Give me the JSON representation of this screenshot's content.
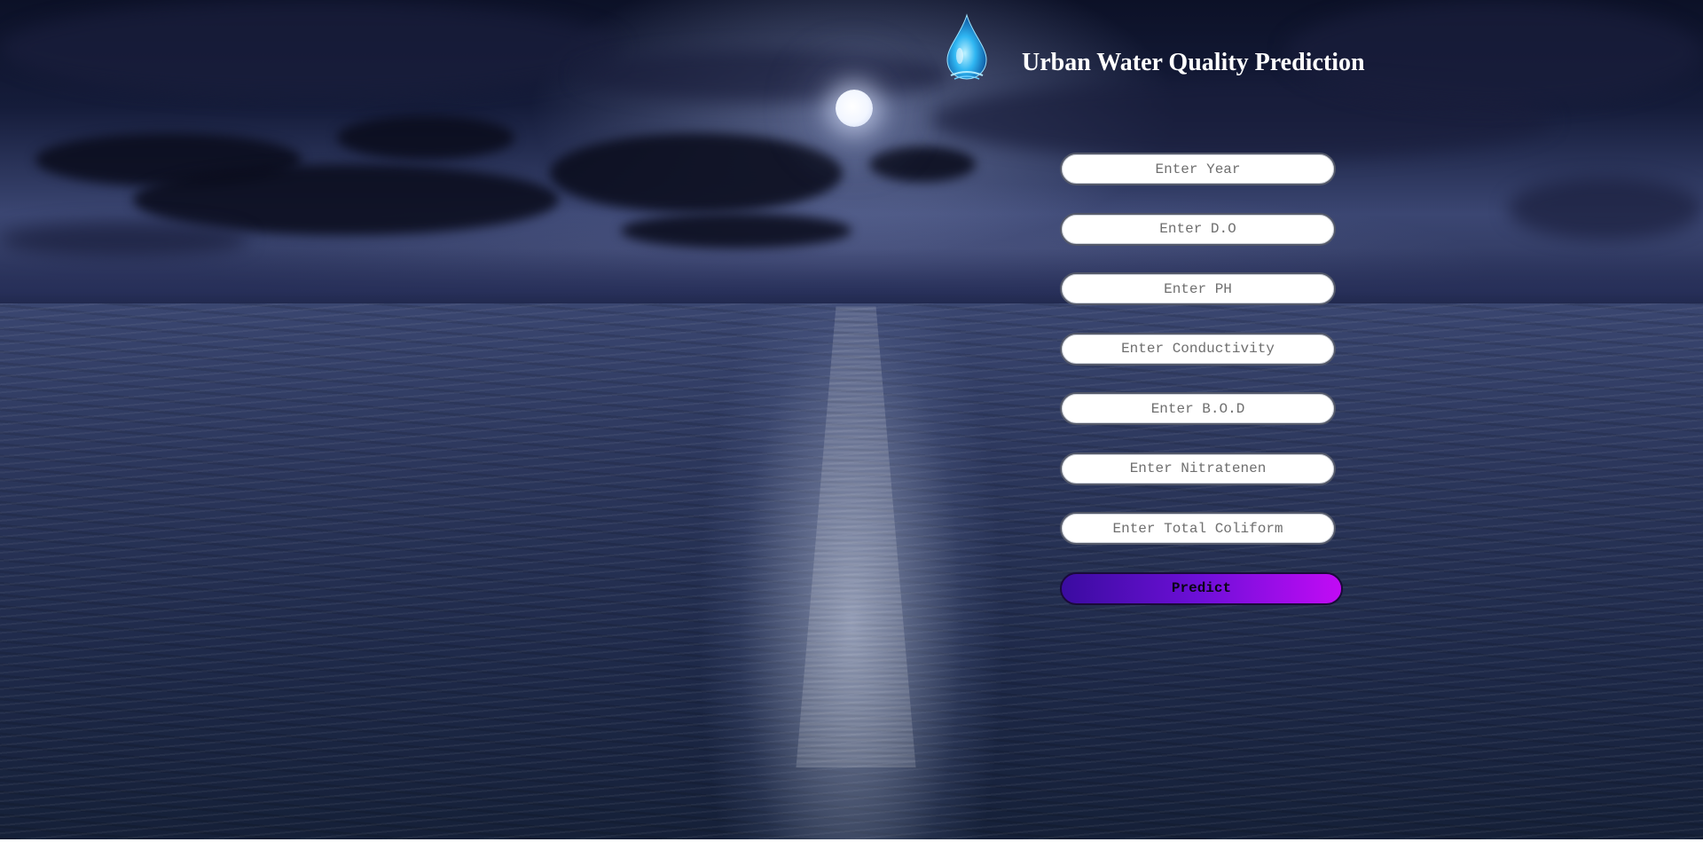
{
  "header": {
    "title": "Urban Water Quality Prediction",
    "logo_icon": "water-drop-icon"
  },
  "form": {
    "fields": [
      {
        "key": "year",
        "placeholder": "Enter Year",
        "value": ""
      },
      {
        "key": "do",
        "placeholder": "Enter D.O",
        "value": ""
      },
      {
        "key": "ph",
        "placeholder": "Enter PH",
        "value": ""
      },
      {
        "key": "conductivity",
        "placeholder": "Enter Conductivity",
        "value": ""
      },
      {
        "key": "bod",
        "placeholder": "Enter B.O.D",
        "value": ""
      },
      {
        "key": "nitratenen",
        "placeholder": "Enter Nitratenen",
        "value": ""
      },
      {
        "key": "total_coliform",
        "placeholder": "Enter Total Coliform",
        "value": ""
      }
    ],
    "submit_label": "Predict"
  },
  "colors": {
    "title": "#ffffff",
    "button_gradient_start": "#3a0ca0",
    "button_gradient_end": "#c20bf5",
    "input_background": "#ffffff"
  }
}
